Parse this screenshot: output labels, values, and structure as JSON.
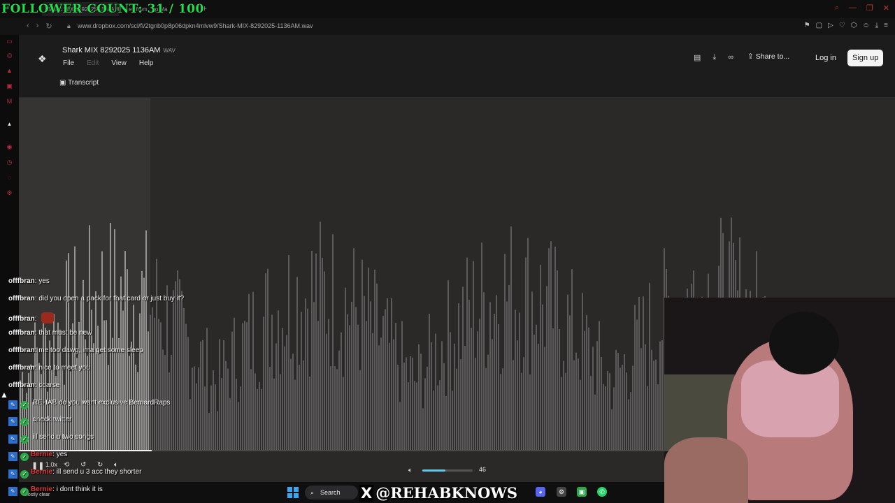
{
  "overlay": {
    "follower_count": "FOLLOWER COUNT: 31 / 100",
    "handle": "@REHABKNOWS",
    "handle_icon": "x-logo-icon"
  },
  "browser": {
    "tabs": [
      {
        "label": "Shark MIX 8292025 1136AM.wav"
      },
      {
        "label": "es from...ng Ma"
      }
    ],
    "url": "www.dropbox.com/scl/fi/2tgnb0p8p06dpkn4mlvw9/Shark-MIX-8292025-1136AM.wav"
  },
  "file": {
    "name": "Shark MIX 8292025 1136AM",
    "ext": "WAV"
  },
  "menu": {
    "file": "File",
    "edit": "Edit",
    "view": "View",
    "help": "Help"
  },
  "transcript_label": "Transcript",
  "header": {
    "share": "Share to...",
    "login": "Log in",
    "signup": "Sign up"
  },
  "player": {
    "progress_fraction": 0.152,
    "speed": "1.0x",
    "skip_back": "10",
    "skip_fwd": "10",
    "volume": "46",
    "accent": "#62c7e8"
  },
  "chat": [
    {
      "user": "offfbran",
      "text": "yes"
    },
    {
      "user": "offfbran",
      "text": "did you open a pack for that card or just buy it?"
    },
    {
      "user": "offfbran",
      "text": ""
    },
    {
      "user": "offfbran",
      "text": "that must be new"
    },
    {
      "user": "offfbran",
      "text": "me too dawg, ima get some sleep"
    },
    {
      "user": "offfbran",
      "text": "nice to meet you"
    },
    {
      "user": "offfbran",
      "text": "coarse"
    },
    {
      "user": "",
      "text": "REHAB do you want exclusive BernardRaps"
    },
    {
      "user": "",
      "text": "check twitter"
    },
    {
      "user": "",
      "text": "ill send u two songs"
    },
    {
      "user": "Bernie",
      "text": "yes"
    },
    {
      "user": "Bernie",
      "text": "ill send u 3 acc they shorter"
    },
    {
      "user": "Bernie",
      "text": "i dont think it is"
    }
  ],
  "taskbar": {
    "weather": "Mostly clear",
    "search": "Search"
  }
}
